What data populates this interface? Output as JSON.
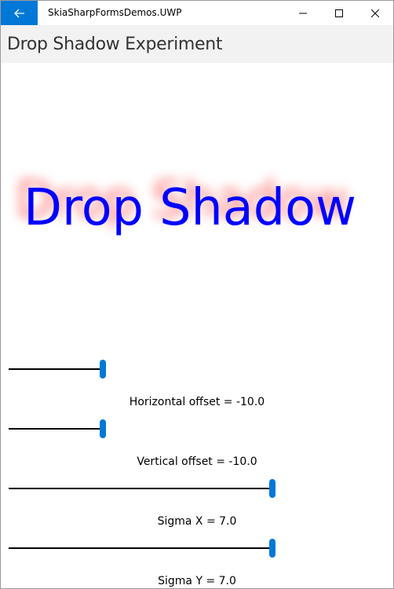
{
  "window": {
    "app_title": "SkiaSharpFormsDemos.UWP",
    "accent_color": "#0078d7"
  },
  "page": {
    "title": "Drop Shadow Experiment"
  },
  "canvas": {
    "text": "Drop Shadow",
    "text_color": "#0000ff",
    "shadow_color": "#ff0000"
  },
  "controls": [
    {
      "name": "horizontal-offset",
      "label": "Horizontal offset = -10.0",
      "fraction": 0.25
    },
    {
      "name": "vertical-offset",
      "label": "Vertical offset = -10.0",
      "fraction": 0.25
    },
    {
      "name": "sigma-x",
      "label": "Sigma X = 7.0",
      "fraction": 0.7
    },
    {
      "name": "sigma-y",
      "label": "Sigma Y = 7.0",
      "fraction": 0.7
    }
  ],
  "icons": {
    "back": "back-arrow-icon",
    "minimize": "minimize-icon",
    "maximize": "maximize-icon",
    "close": "close-icon"
  }
}
